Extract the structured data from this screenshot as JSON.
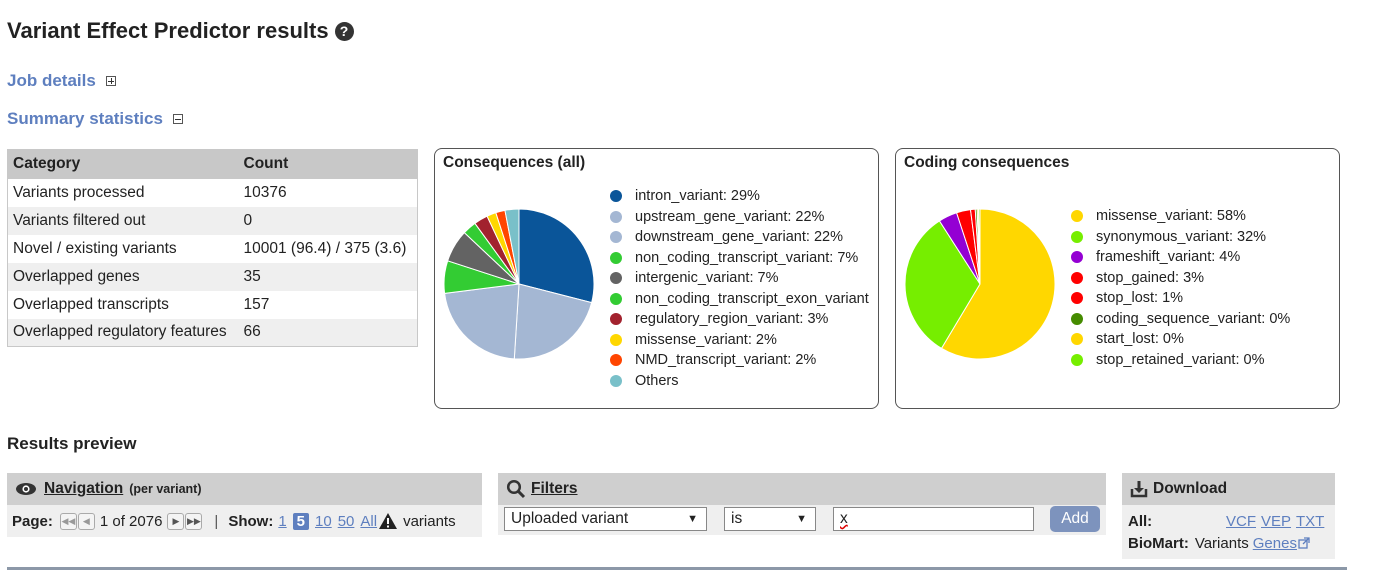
{
  "page": {
    "title": "Variant Effect Predictor results",
    "help_glyph": "?"
  },
  "sections": {
    "job_details": "Job details",
    "summary_statistics": "Summary statistics",
    "results_preview": "Results preview"
  },
  "stats_table": {
    "headers": [
      "Category",
      "Count"
    ],
    "rows": [
      [
        "Variants processed",
        "10376"
      ],
      [
        "Variants filtered out",
        "0"
      ],
      [
        "Novel / existing variants",
        "10001 (96.4) / 375 (3.6)"
      ],
      [
        "Overlapped genes",
        "35"
      ],
      [
        "Overlapped transcripts",
        "157"
      ],
      [
        "Overlapped regulatory features",
        "66"
      ]
    ]
  },
  "chart_data": [
    {
      "type": "pie",
      "title": "Consequences (all)",
      "slices": [
        {
          "label": "intron_variant: 29%",
          "value": 29,
          "color": "#0a5599"
        },
        {
          "label": "upstream_gene_variant: 22%",
          "value": 22,
          "color": "#a4b7d3"
        },
        {
          "label": "downstream_gene_variant: 22%",
          "value": 22,
          "color": "#a4b7d3"
        },
        {
          "label": "non_coding_transcript_variant: 7%",
          "value": 7,
          "color": "#33cc33"
        },
        {
          "label": "intergenic_variant: 7%",
          "value": 7,
          "color": "#636363"
        },
        {
          "label": "non_coding_transcript_exon_variant",
          "value": 3,
          "color": "#33cc33"
        },
        {
          "label": "regulatory_region_variant: 3%",
          "value": 3,
          "color": "#a2222e"
        },
        {
          "label": "missense_variant: 2%",
          "value": 2,
          "color": "#ffd700"
        },
        {
          "label": "NMD_transcript_variant: 2%",
          "value": 2,
          "color": "#ff4500"
        },
        {
          "label": "Others",
          "value": 3,
          "color": "#79c0c9"
        }
      ]
    },
    {
      "type": "pie",
      "title": "Coding consequences",
      "slices": [
        {
          "label": "missense_variant: 58%",
          "value": 58,
          "color": "#ffd700"
        },
        {
          "label": "synonymous_variant: 32%",
          "value": 32,
          "color": "#76ee00"
        },
        {
          "label": "frameshift_variant: 4%",
          "value": 4,
          "color": "#9400d3"
        },
        {
          "label": "stop_gained: 3%",
          "value": 3,
          "color": "#ff0000"
        },
        {
          "label": "stop_lost: 1%",
          "value": 1,
          "color": "#ff0000"
        },
        {
          "label": "coding_sequence_variant: 0%",
          "value": 0.4,
          "color": "#458b00"
        },
        {
          "label": "start_lost: 0%",
          "value": 0.3,
          "color": "#ffd700"
        },
        {
          "label": "stop_retained_variant: 0%",
          "value": 0.3,
          "color": "#76ee00"
        }
      ]
    }
  ],
  "navigation": {
    "title": "Navigation",
    "subtitle": "(per variant)",
    "page_label": "Page:",
    "page_text": "1 of 2076",
    "separator": "|",
    "show_label": "Show:",
    "show_options": [
      "1",
      "5",
      "10",
      "50",
      "All"
    ],
    "variants_label": "variants",
    "icons": [
      "first-page-icon",
      "prev-page-icon",
      "next-page-icon",
      "last-page-icon",
      "warning-icon",
      "eye-icon"
    ]
  },
  "filters": {
    "title": "Filters",
    "field_select": "Uploaded variant",
    "operator_select": "is",
    "value_input": "x",
    "add_label": "Add"
  },
  "download": {
    "title": "Download",
    "all_label": "All:",
    "all_links": [
      "VCF",
      "VEP",
      "TXT"
    ],
    "biomart_label": "BioMart:",
    "biomart_text": "Variants",
    "biomart_link": "Genes"
  }
}
